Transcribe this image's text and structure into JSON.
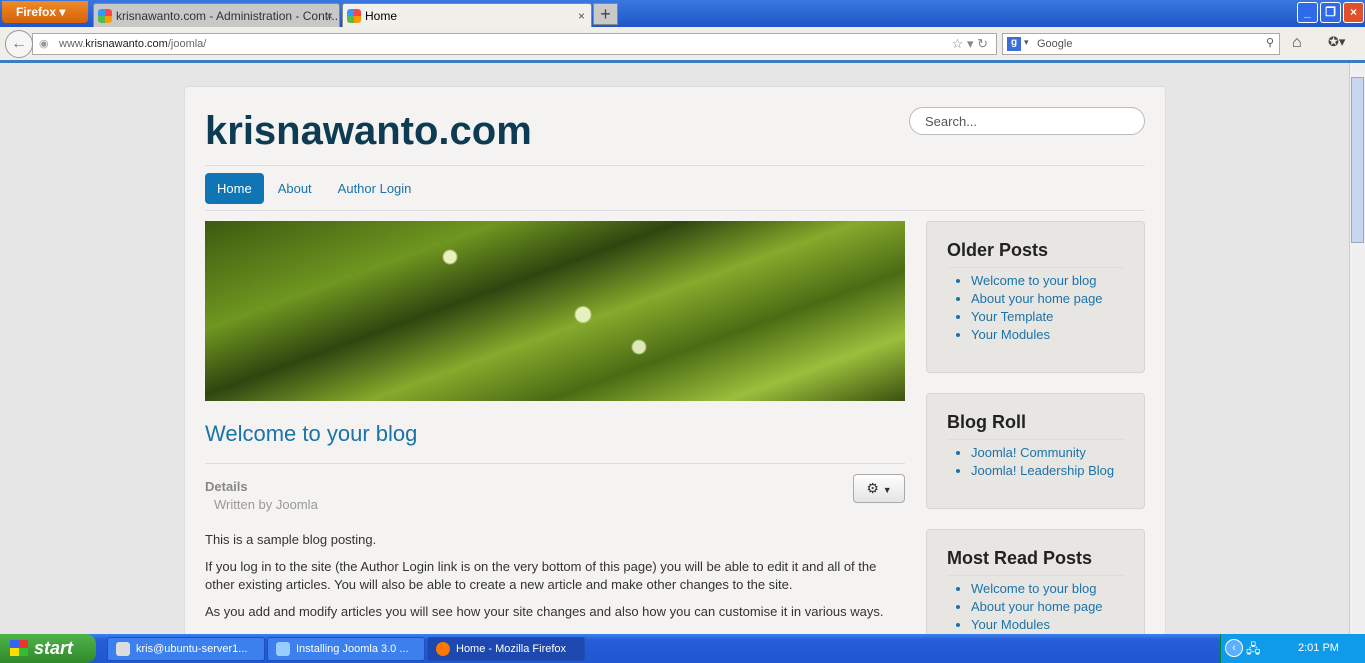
{
  "browser": {
    "menu_button": "Firefox",
    "tabs": [
      {
        "label": "krisnawanto.com - Administration - Contr..."
      },
      {
        "label": "Home"
      }
    ],
    "url_prefix": "www.",
    "url_domain": "krisnawanto.com",
    "url_path": "/joomla/",
    "search_engine": "Google",
    "search_placeholder": "Google"
  },
  "site": {
    "brand": "krisnawanto.com",
    "search_placeholder": "Search...",
    "menu": [
      {
        "label": "Home",
        "active": true
      },
      {
        "label": "About"
      },
      {
        "label": "Author Login"
      }
    ],
    "article": {
      "title": "Welcome to your blog",
      "details_label": "Details",
      "written_by": "Written by Joomla",
      "paragraphs": [
        "This is a sample blog posting.",
        "If you log in to the site (the Author Login link is on the very bottom of this page) you will be able to edit it and all of the other existing articles. You will also be able to create a new article and make other changes to the site.",
        "As you add and modify articles you will see how your site changes and also how you can customise it in various ways."
      ]
    },
    "sidebar": [
      {
        "title": "Older Posts",
        "items": [
          "Welcome to your blog",
          "About your home page",
          "Your Template",
          "Your Modules"
        ]
      },
      {
        "title": "Blog Roll",
        "items": [
          "Joomla! Community",
          "Joomla! Leadership Blog"
        ]
      },
      {
        "title": "Most Read Posts",
        "items": [
          "Welcome to your blog",
          "About your home page",
          "Your Modules"
        ]
      }
    ]
  },
  "taskbar": {
    "start_label": "start",
    "tasks": [
      {
        "label": "kris@ubuntu-server1..."
      },
      {
        "label": "Installing Joomla 3.0 ..."
      },
      {
        "label": "Home - Mozilla Firefox",
        "active": true
      }
    ],
    "clock": "2:01 PM"
  },
  "colors": {
    "accent": "#0f75b4",
    "brand": "#0d3b52",
    "link": "#1b73a8"
  }
}
